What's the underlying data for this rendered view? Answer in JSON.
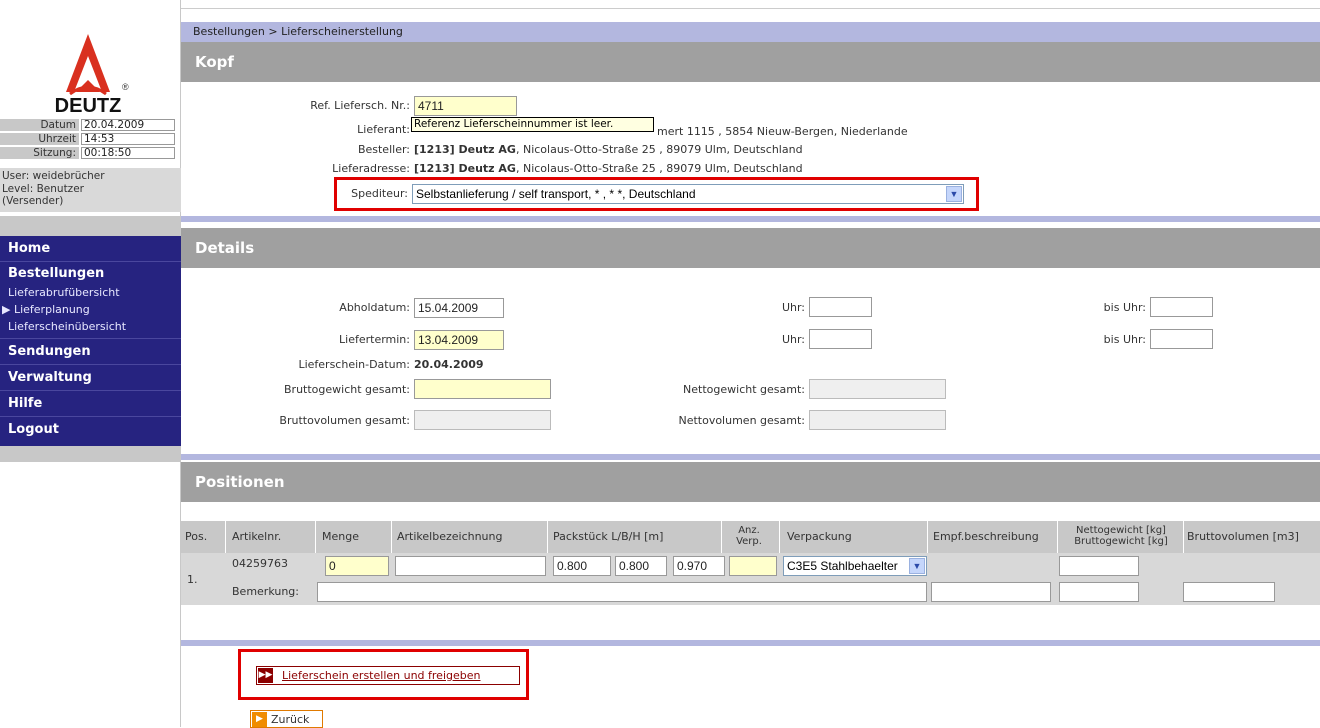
{
  "sidebar": {
    "logo_text": "DEUTZ",
    "info": [
      {
        "label": "Datum",
        "value": "20.04.2009"
      },
      {
        "label": "Uhrzeit",
        "value": "14:53"
      },
      {
        "label": "Sitzung:",
        "value": "00:18:50"
      }
    ],
    "user_line": "User: weidebrücher",
    "level_line": "Level: Benutzer",
    "role_line": "(Versender)",
    "nav": {
      "home": "Home",
      "bestellungen": "Bestellungen",
      "sub_lieferabruf": "Lieferabrufübersicht",
      "sub_lieferplanung": "Lieferplanung",
      "sub_lieferschein": "Lieferscheinübersicht",
      "sendungen": "Sendungen",
      "verwaltung": "Verwaltung",
      "hilfe": "Hilfe",
      "logout": "Logout"
    }
  },
  "breadcrumb": "Bestellungen > Lieferscheinerstellung",
  "kopf": {
    "title": "Kopf",
    "ref_label": "Ref. Liefersch. Nr.:",
    "ref_value": "4711",
    "tooltip": "Referenz Lieferscheinnummer ist leer.",
    "lieferant_label": "Lieferant:",
    "lieferant_tail": "mert 1115 , 5854 Nieuw-Bergen, Niederlande",
    "besteller_label": "Besteller:",
    "besteller_bold": "[1213] Deutz AG",
    "besteller_rest": ", Nicolaus-Otto-Straße 25 , 89079 Ulm, Deutschland",
    "lieferadresse_label": "Lieferadresse:",
    "lieferadresse_bold": "[1213] Deutz AG",
    "lieferadresse_rest": ", Nicolaus-Otto-Straße 25 , 89079 Ulm, Deutschland",
    "spediteur_label": "Spediteur:",
    "spediteur_value": "Selbstanlieferung / self transport, * , * *, Deutschland"
  },
  "details": {
    "title": "Details",
    "abholdatum_label": "Abholdatum:",
    "abholdatum_value": "15.04.2009",
    "liefertermin_label": "Liefertermin:",
    "liefertermin_value": "13.04.2009",
    "uhr_label": "Uhr:",
    "bis_uhr_label": "bis Uhr:",
    "lieferschein_datum_label": "Lieferschein-Datum:",
    "lieferschein_datum_value": "20.04.2009",
    "brutto_gewicht_label": "Bruttogewicht gesamt:",
    "netto_gewicht_label": "Nettogewicht gesamt:",
    "brutto_volumen_label": "Bruttovolumen gesamt:",
    "netto_volumen_label": "Nettovolumen gesamt:"
  },
  "positionen": {
    "title": "Positionen",
    "headers": {
      "pos": "Pos.",
      "artikelnr": "Artikelnr.",
      "menge": "Menge",
      "artikelbezeichnung": "Artikelbezeichnung",
      "packstueck": "Packstück L/B/H [m]",
      "anz_verp_1": "Anz.",
      "anz_verp_2": "Verp.",
      "verpackung": "Verpackung",
      "empf": "Empf.beschreibung",
      "netto_1": "Nettogewicht [kg]",
      "netto_2": "Bruttogewicht [kg]",
      "bruttovolumen": "Bruttovolumen [m3]"
    },
    "row": {
      "pos": "1.",
      "artikelnr": "04259763",
      "menge": "0",
      "length": "0.800",
      "width": "0.800",
      "height": "0.970",
      "verpackung": "C3E5 Stahlbehaelter",
      "bemerkung_label": "Bemerkung:"
    }
  },
  "actions": {
    "create": "Lieferschein erstellen und freigeben",
    "back": "Zurück"
  },
  "colors": {
    "nav_bg": "#262380",
    "highlight_border": "#e00000",
    "required_field": "#ffffcc"
  }
}
